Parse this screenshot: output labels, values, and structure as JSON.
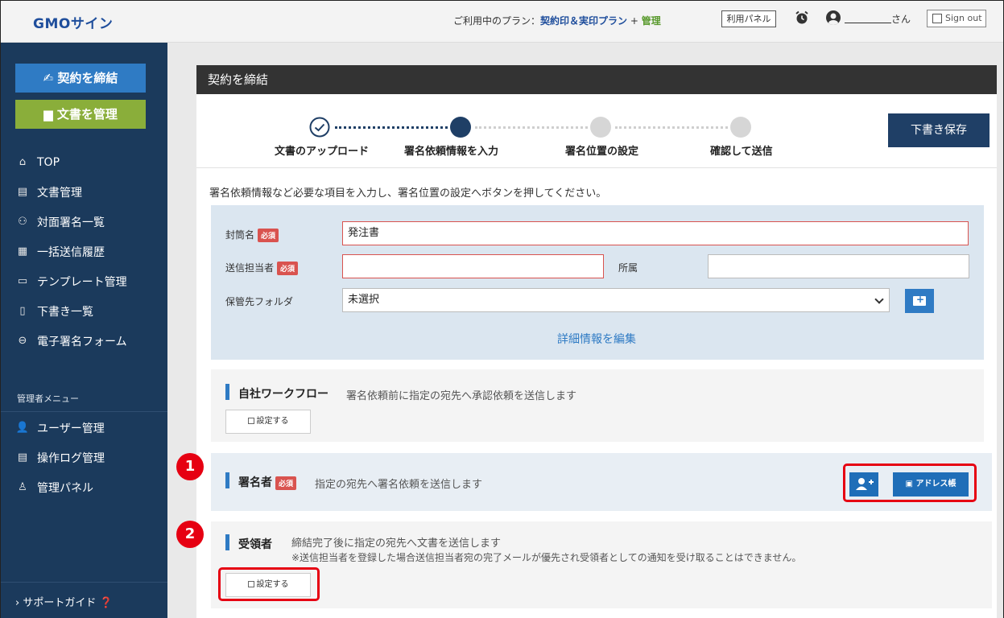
{
  "header": {
    "logo": "GMOサイン",
    "plan_prefix": "ご利用中のプラン：",
    "plan_name": "契約印＆実印プラン",
    "plan_plus": " + ",
    "plan_admin": "管理",
    "panel_button": "利用パネル",
    "user_suffix": "さん",
    "signout": "Sign out"
  },
  "sidebar": {
    "contract_button": "契約を締結",
    "manage_button": "文書を管理",
    "items": [
      {
        "label": "TOP",
        "icon": "home-icon"
      },
      {
        "label": "文書管理",
        "icon": "document-icon"
      },
      {
        "label": "対面署名一覧",
        "icon": "face-to-face-icon"
      },
      {
        "label": "一括送信履歴",
        "icon": "bulk-send-icon"
      },
      {
        "label": "テンプレート管理",
        "icon": "template-icon"
      },
      {
        "label": "下書き一覧",
        "icon": "draft-icon"
      },
      {
        "label": "電子署名フォーム",
        "icon": "link-icon"
      }
    ],
    "admin_title": "管理者メニュー",
    "admin_items": [
      {
        "label": "ユーザー管理",
        "icon": "user-icon"
      },
      {
        "label": "操作ログ管理",
        "icon": "log-icon"
      },
      {
        "label": "管理パネル",
        "icon": "admin-panel-icon"
      }
    ],
    "support": "サポートガイド"
  },
  "main": {
    "card_title": "契約を締結",
    "save_draft": "下書き保存",
    "steps": [
      {
        "label": "文書のアップロード",
        "state": "done"
      },
      {
        "label": "署名依頼情報を入力",
        "state": "current"
      },
      {
        "label": "署名位置の設定",
        "state": "todo"
      },
      {
        "label": "確認して送信",
        "state": "todo"
      }
    ],
    "instruction": "署名依頼情報など必要な項目を入力し、署名位置の設定へボタンを押してください。",
    "form": {
      "envelope_label": "封筒名",
      "required": "必須",
      "envelope_value": "発注書",
      "sender_label": "送信担当者",
      "sender_value": "",
      "affiliation_label": "所属",
      "affiliation_value": "",
      "folder_label": "保管先フォルダ",
      "folder_value": "未選択",
      "edit_details": "詳細情報を編集"
    },
    "workflow": {
      "title": "自社ワークフロー",
      "desc": "署名依頼前に指定の宛先へ承認依頼を送信します",
      "button": "設定する"
    },
    "signer": {
      "title": "署名者",
      "required": "必須",
      "desc": "指定の宛先へ署名依頼を送信します",
      "address_book": "アドレス帳"
    },
    "receiver": {
      "title": "受領者",
      "desc": "締結完了後に指定の宛先へ文書を送信します",
      "note": "※送信担当者を登録した場合送信担当者宛の完了メールが優先され受領者としての通知を受け取ることはできません。",
      "button": "設定する"
    }
  },
  "annotations": {
    "badge1": "1",
    "badge2": "2"
  },
  "colors": {
    "sidebar_bg": "#1b3a5c",
    "accent": "#2f7bc4",
    "green": "#8aae3a",
    "required": "#d9534f",
    "highlight": "#e60012"
  }
}
